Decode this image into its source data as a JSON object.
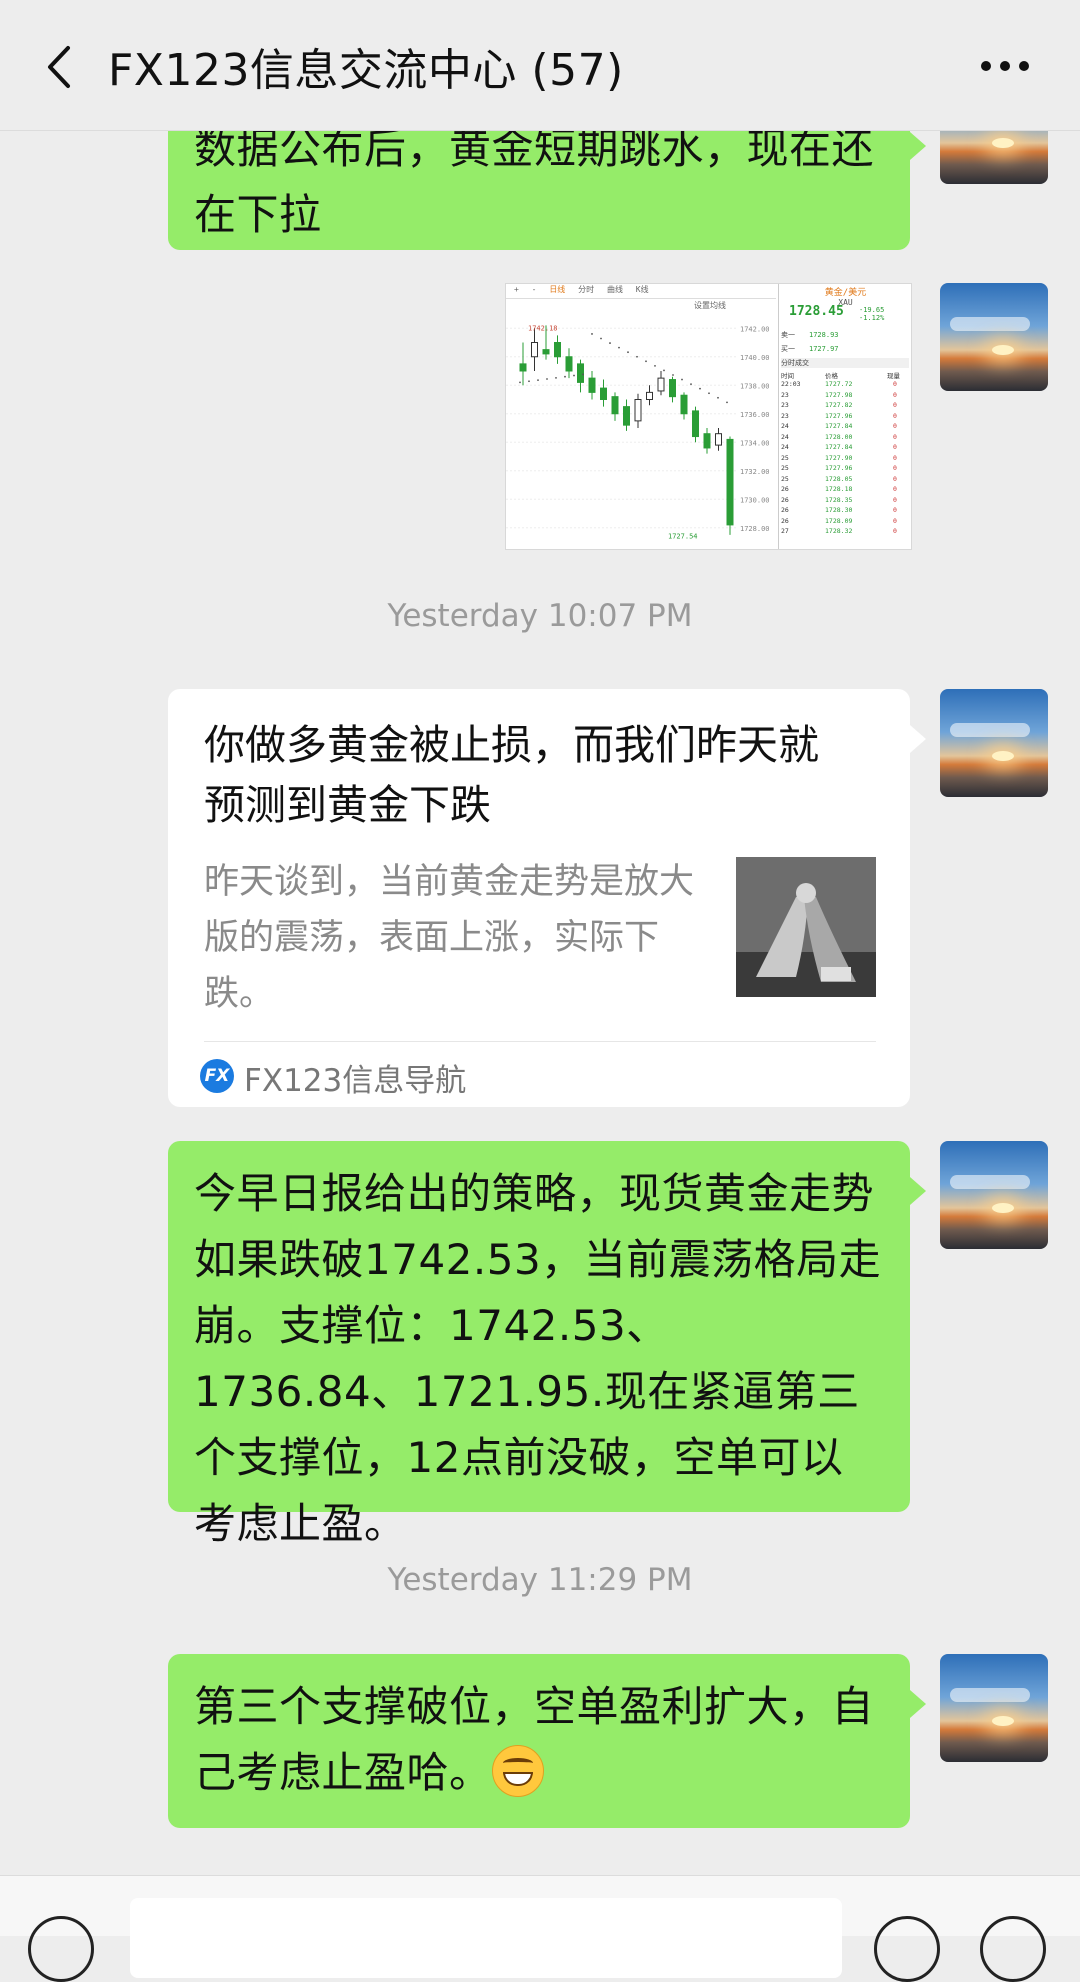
{
  "header": {
    "title": "FX123信息交流中心 (57)"
  },
  "messages": [
    {
      "type": "text",
      "text": "数据公布后，黄金短期跳水，现在还在下拉"
    },
    {
      "type": "image",
      "description": "gold price chart screenshot",
      "chart": {
        "toolbar": [
          "+",
          "-",
          "日线",
          "分时",
          "曲线",
          "K线",
          "设置均线"
        ],
        "price_labels": [
          "1742.18",
          "1727.54"
        ],
        "y_ticks": [
          "1742.00",
          "1740.00",
          "1738.00",
          "1736.00",
          "1734.00",
          "1732.00",
          "1730.00",
          "1728.00"
        ],
        "quote": {
          "title": "黄金/美元",
          "symbol": "XAU",
          "price": "1728.45",
          "change": "-19.65",
          "change_pct": "-1.12%",
          "sell_label": "卖一",
          "sell": "1728.93",
          "buy_label": "买一",
          "buy": "1727.97",
          "ticks_title": "分时成交",
          "ticks_header": [
            "时间",
            "价格",
            "现量"
          ],
          "ticks": [
            {
              "t": "22:03",
              "p": "1727.72",
              "v": "0"
            },
            {
              "t": "23",
              "p": "1727.98",
              "v": "0"
            },
            {
              "t": "23",
              "p": "1727.82",
              "v": "0"
            },
            {
              "t": "23",
              "p": "1727.96",
              "v": "0"
            },
            {
              "t": "24",
              "p": "1727.84",
              "v": "0"
            },
            {
              "t": "24",
              "p": "1728.00",
              "v": "0"
            },
            {
              "t": "24",
              "p": "1727.84",
              "v": "0"
            },
            {
              "t": "25",
              "p": "1727.90",
              "v": "0"
            },
            {
              "t": "25",
              "p": "1727.96",
              "v": "0"
            },
            {
              "t": "25",
              "p": "1728.05",
              "v": "0"
            },
            {
              "t": "26",
              "p": "1728.18",
              "v": "0"
            },
            {
              "t": "26",
              "p": "1728.35",
              "v": "0"
            },
            {
              "t": "26",
              "p": "1728.30",
              "v": "0"
            },
            {
              "t": "26",
              "p": "1728.09",
              "v": "0"
            },
            {
              "t": "27",
              "p": "1728.32",
              "v": "0"
            }
          ]
        }
      }
    },
    {
      "type": "timestamp",
      "text": "Yesterday 10:07 PM"
    },
    {
      "type": "link_card",
      "title": "你做多黄金被止损，而我们昨天就预测到黄金下跌",
      "description": "昨天谈到，当前黄金走势是放大版的震荡，表面上涨，实际下跌。",
      "source": "FX123信息导航",
      "source_icon": "FX"
    },
    {
      "type": "text",
      "text": "今早日报给出的策略，现货黄金走势如果跌破1742.53，当前震荡格局走崩。支撑位：1742.53、1736.84、1721.95.现在紧逼第三个支撑位，12点前没破，空单可以考虑止盈。"
    },
    {
      "type": "timestamp",
      "text": "Yesterday 11:29 PM"
    },
    {
      "type": "text",
      "text": "第三个支撑破位，空单盈利扩大，自己考虑止盈哈。",
      "emoji": "grinning-face"
    }
  ],
  "colors": {
    "bubble_green": "#95ec69",
    "background": "#ededed",
    "chart_up": "#2a9d36",
    "chart_accent": "#e07a1b"
  }
}
